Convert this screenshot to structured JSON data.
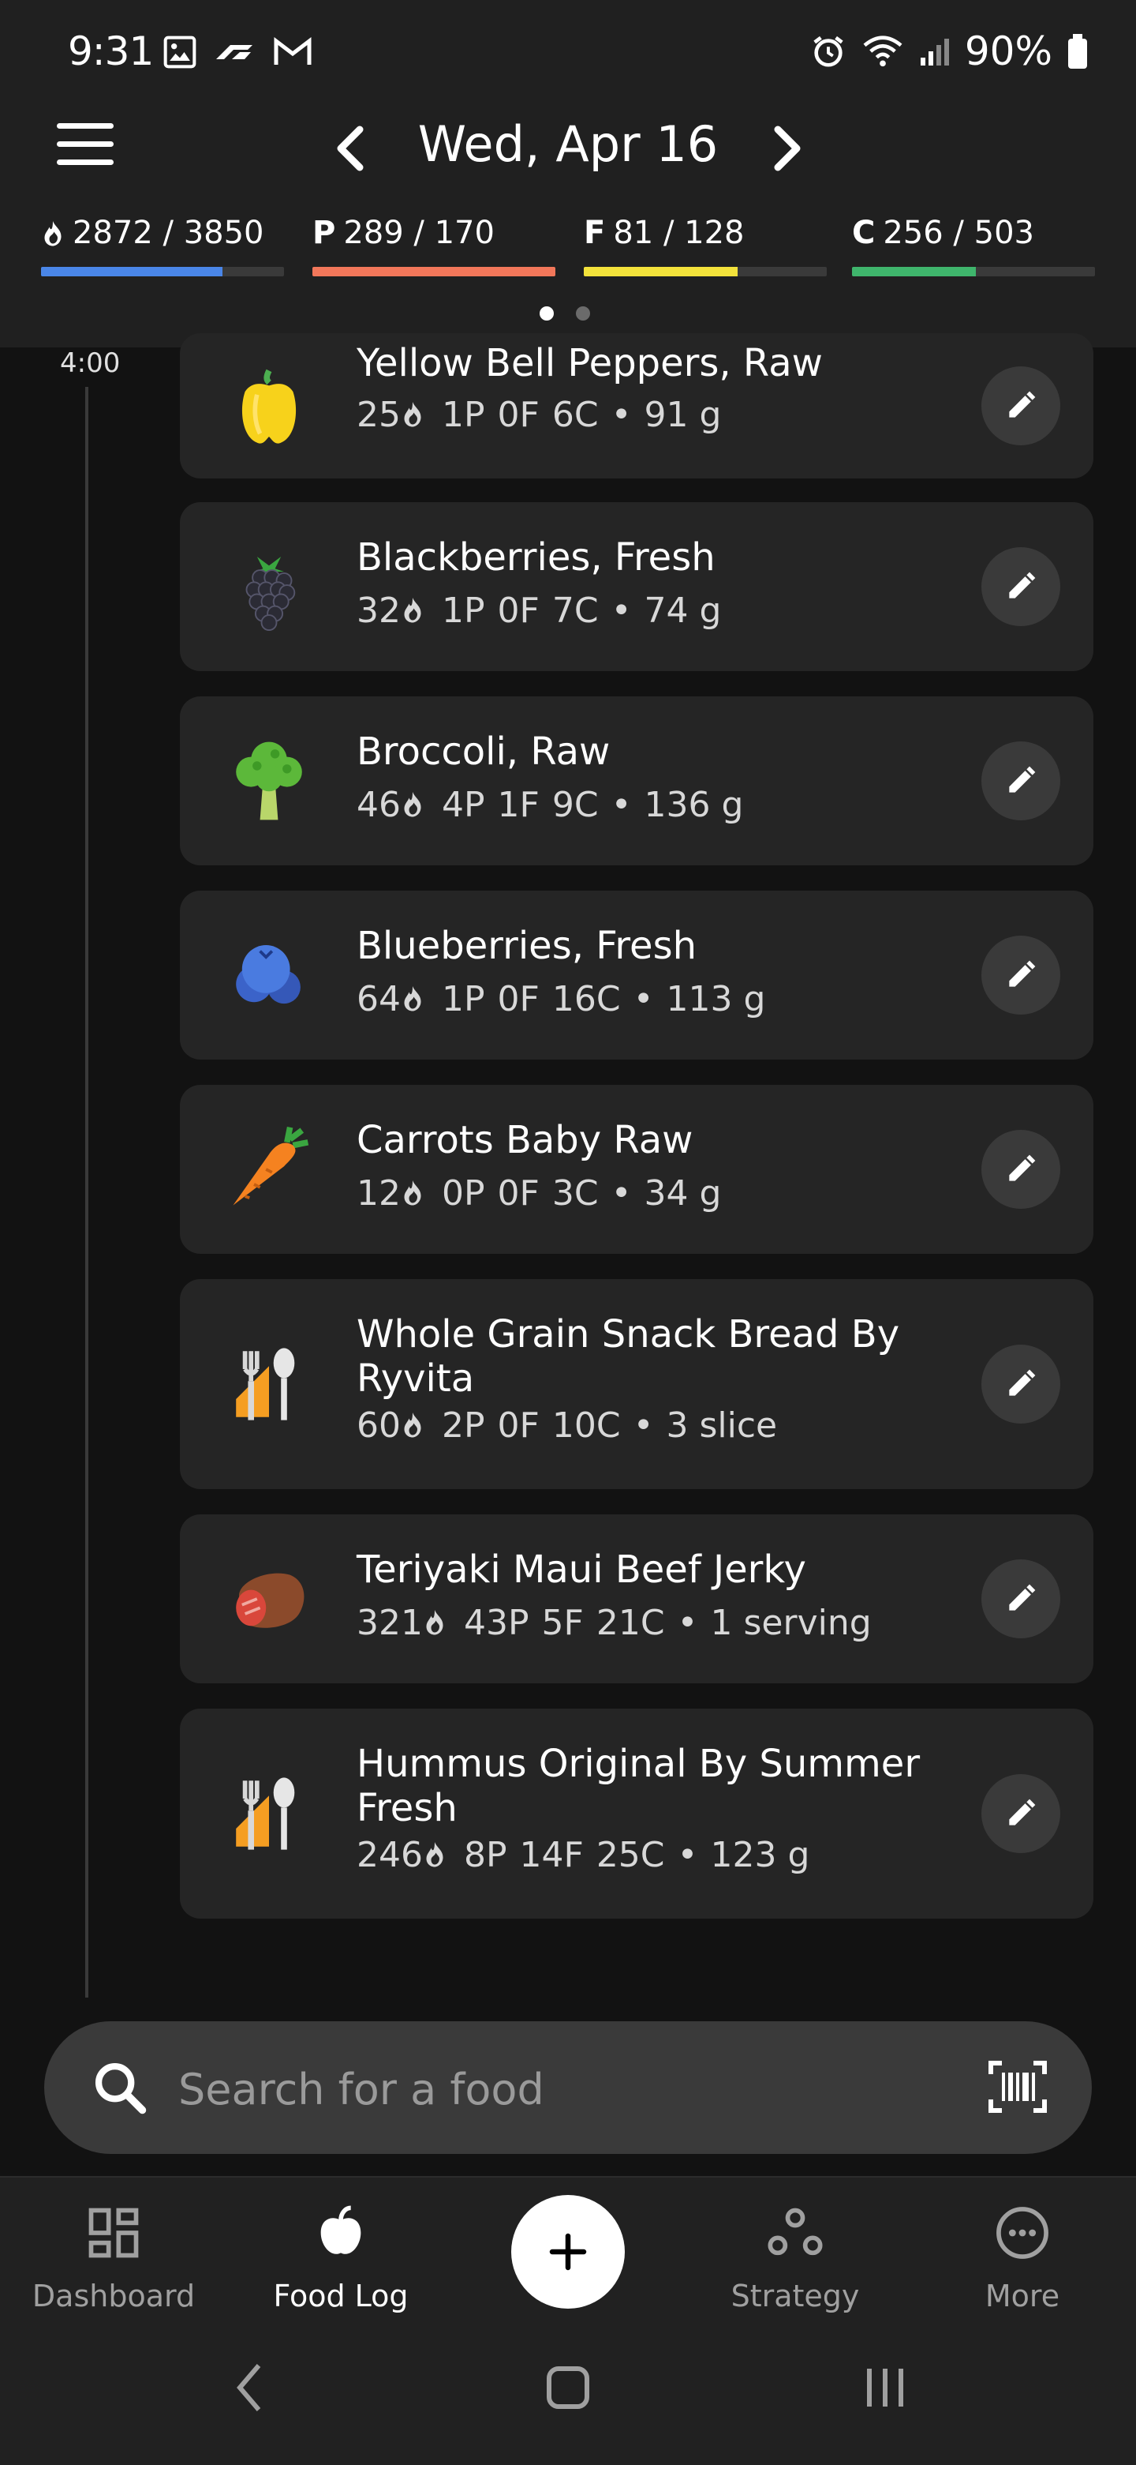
{
  "status_bar": {
    "time": "9:31",
    "battery": "90%"
  },
  "header": {
    "date": "Wed, Apr 16"
  },
  "macros": [
    {
      "prefix": "",
      "value": "2872 / 3850",
      "color": "#4a86e8",
      "progress": 0.746
    },
    {
      "prefix": "P",
      "value": "289 / 170",
      "color": "#f2775a",
      "progress": 1.0
    },
    {
      "prefix": "F",
      "value": "81 / 128",
      "color": "#f3e23b",
      "progress": 0.633
    },
    {
      "prefix": "C",
      "value": "256 / 503",
      "color": "#3fb56c",
      "progress": 0.509
    }
  ],
  "timeline": {
    "time_label": "4:00"
  },
  "foods": [
    {
      "name": "Yellow Bell Peppers, Raw",
      "cal": "25",
      "p": "1P",
      "f": "0F",
      "c": "6C",
      "amount": "91 g",
      "icon": "yellow-pepper-icon"
    },
    {
      "name": "Blackberries, Fresh",
      "cal": "32",
      "p": "1P",
      "f": "0F",
      "c": "7C",
      "amount": "74 g",
      "icon": "blackberry-icon"
    },
    {
      "name": "Broccoli, Raw",
      "cal": "46",
      "p": "4P",
      "f": "1F",
      "c": "9C",
      "amount": "136 g",
      "icon": "broccoli-icon"
    },
    {
      "name": "Blueberries, Fresh",
      "cal": "64",
      "p": "1P",
      "f": "0F",
      "c": "16C",
      "amount": "113 g",
      "icon": "blueberry-icon"
    },
    {
      "name": "Carrots Baby Raw",
      "cal": "12",
      "p": "0P",
      "f": "0F",
      "c": "3C",
      "amount": "34 g",
      "icon": "carrot-icon"
    },
    {
      "name": "Whole Grain Snack Bread By Ryvita",
      "cal": "60",
      "p": "2P",
      "f": "0F",
      "c": "10C",
      "amount": "3 slice",
      "icon": "utensils-icon"
    },
    {
      "name": "Teriyaki Maui Beef Jerky",
      "cal": "321",
      "p": "43P",
      "f": "5F",
      "c": "21C",
      "amount": "1 serving",
      "icon": "meat-icon"
    },
    {
      "name": "Hummus Original By Summer Fresh",
      "cal": "246",
      "p": "8P",
      "f": "14F",
      "c": "25C",
      "amount": "123 g",
      "icon": "utensils-icon"
    }
  ],
  "search": {
    "placeholder": "Search for a food"
  },
  "nav": {
    "dashboard": "Dashboard",
    "food_log": "Food Log",
    "strategy": "Strategy",
    "more": "More"
  }
}
